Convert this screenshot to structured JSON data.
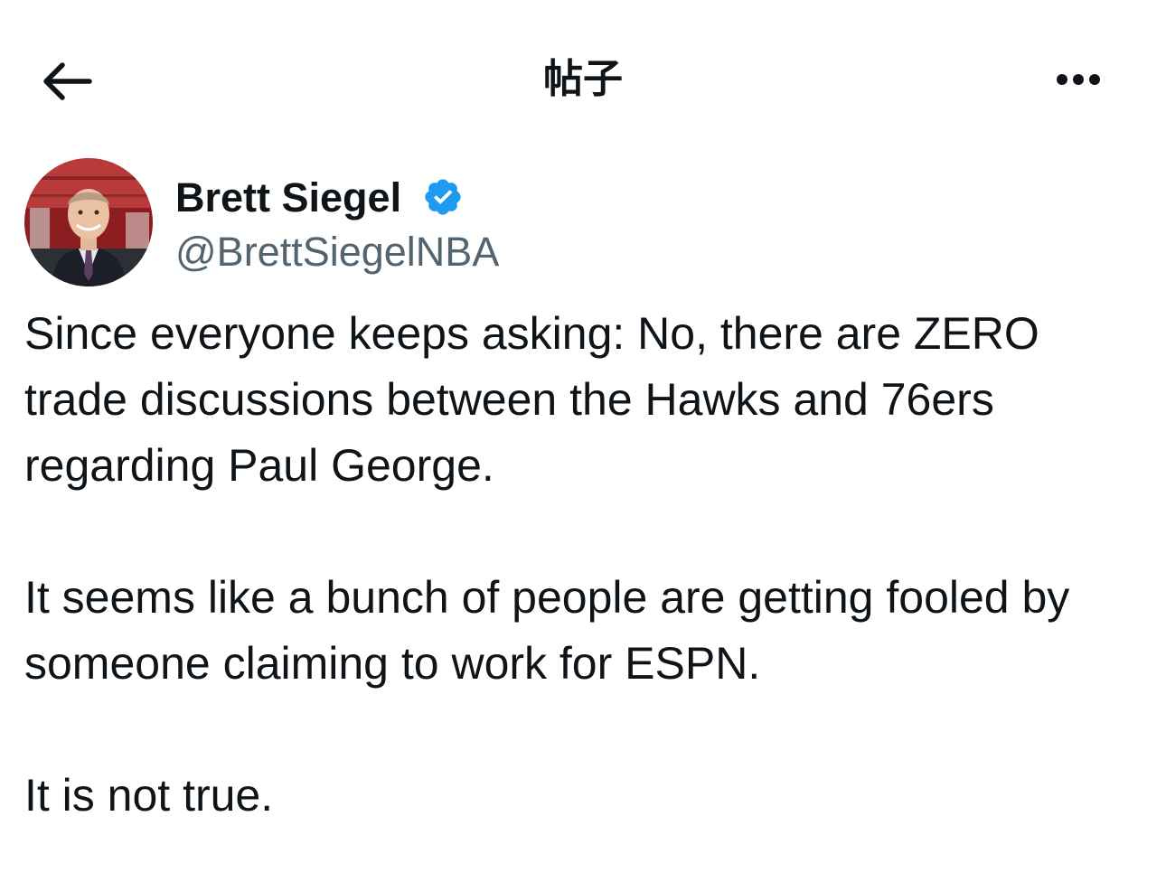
{
  "header": {
    "title": "帖子",
    "back_icon": "arrow-left-icon",
    "more_icon": "more-horizontal-icon"
  },
  "post": {
    "author": {
      "name": "Brett Siegel",
      "handle": "@BrettSiegelNBA",
      "verified": true,
      "verified_icon": "verified-badge-icon",
      "verified_color": "#1d9bf0"
    },
    "paragraphs": [
      "Since everyone keeps asking: No, there are ZERO trade discussions between the Hawks and 76ers regarding Paul George.",
      "It seems like a bunch of people are getting fooled by someone claiming to work for ESPN.",
      "It is not true."
    ]
  },
  "colors": {
    "text_primary": "#0f1419",
    "text_secondary": "#536471",
    "background": "#ffffff"
  }
}
